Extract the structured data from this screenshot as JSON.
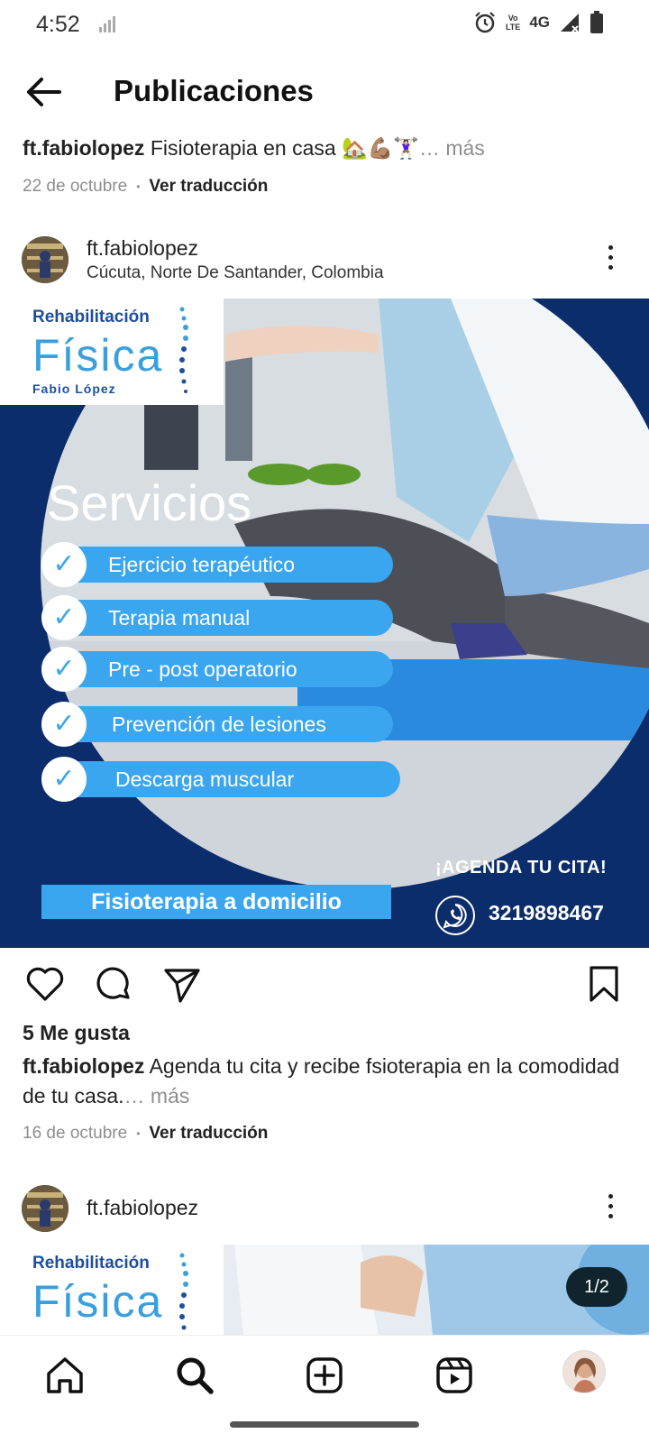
{
  "status_bar": {
    "time": "4:52",
    "network": "4G",
    "volte_line1": "Vo",
    "volte_line2": "LTE",
    "icons": [
      "signal-weak-icon",
      "alarm-icon",
      "volte-icon",
      "signal-icon",
      "battery-icon"
    ]
  },
  "header": {
    "title": "Publicaciones",
    "back_icon": "back-arrow-icon"
  },
  "post_top_caption": {
    "username": "ft.fabiolopez",
    "text": "Fisioterapia en casa 🏡💪🏽🏋🏻‍♀️",
    "more": "… más",
    "date": "22 de octubre",
    "separator": "•",
    "translate": "Ver traducción"
  },
  "post1": {
    "username": "ft.fabiolopez",
    "location": "Cúcuta, Norte De Santander, Colombia",
    "image": {
      "logo_line1": "Rehabilitación",
      "logo_line2": "Física",
      "logo_line3": "Fabio López",
      "heading": "Servicios",
      "services": [
        "Ejercicio terapéutico",
        "Terapia manual",
        "Pre - post operatorio",
        "Prevención de lesiones",
        "Descarga muscular"
      ],
      "banner": "Fisioterapia a domicilio",
      "cta": "¡AGENDA TU CITA!",
      "phone": "3219898467"
    },
    "likes": "5 Me gusta",
    "caption_user": "ft.fabiolopez",
    "caption_text": "Agenda tu cita y recibe fsioterapia en la comodidad de tu casa.",
    "caption_more": "… más",
    "date": "16 de octubre",
    "separator": "•",
    "translate": "Ver traducción"
  },
  "post2": {
    "username": "ft.fabiolopez",
    "logo_line1": "Rehabilitación",
    "logo_line2": "Física",
    "counter": "1/2"
  },
  "bottom_nav": [
    "home-icon",
    "search-icon",
    "create-icon",
    "reels-icon",
    "profile-avatar"
  ],
  "colors": {
    "brand_navy": "#0c2d6b",
    "accent_blue": "#3aa6ef",
    "logo_blue": "#1d4f9e"
  }
}
